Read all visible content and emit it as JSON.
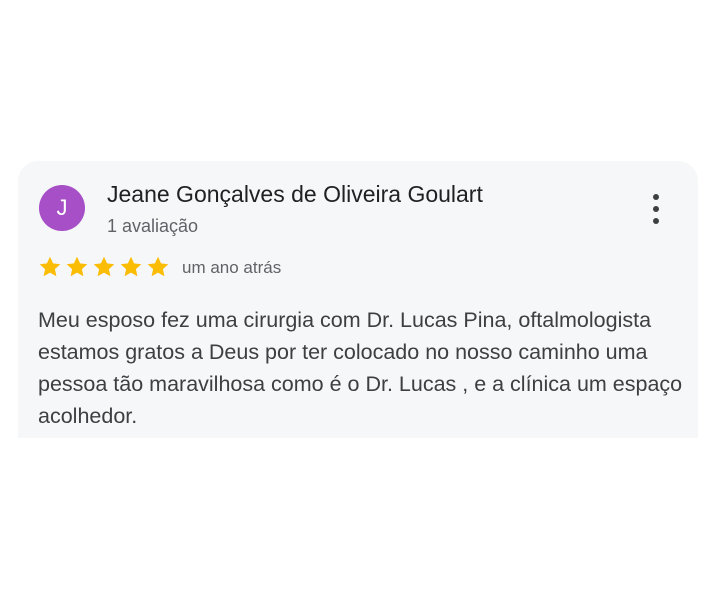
{
  "review": {
    "avatar_initial": "J",
    "avatar_color": "#a64fc6",
    "author_name": "Jeane Gonçalves de Oliveira Goulart",
    "review_count": "1 avaliação",
    "rating": 5,
    "rating_max": 5,
    "star_color": "#fbbc04",
    "time_ago": "um ano atrás",
    "text": "Meu esposo fez uma cirurgia com Dr. Lucas Pina, oftalmologista estamos gratos a Deus por ter colocado no nosso caminho uma pessoa tão maravilhosa como é o Dr. Lucas , e a clínica um espaço acolhedor.",
    "menu_icon": "more-vert-icon"
  }
}
